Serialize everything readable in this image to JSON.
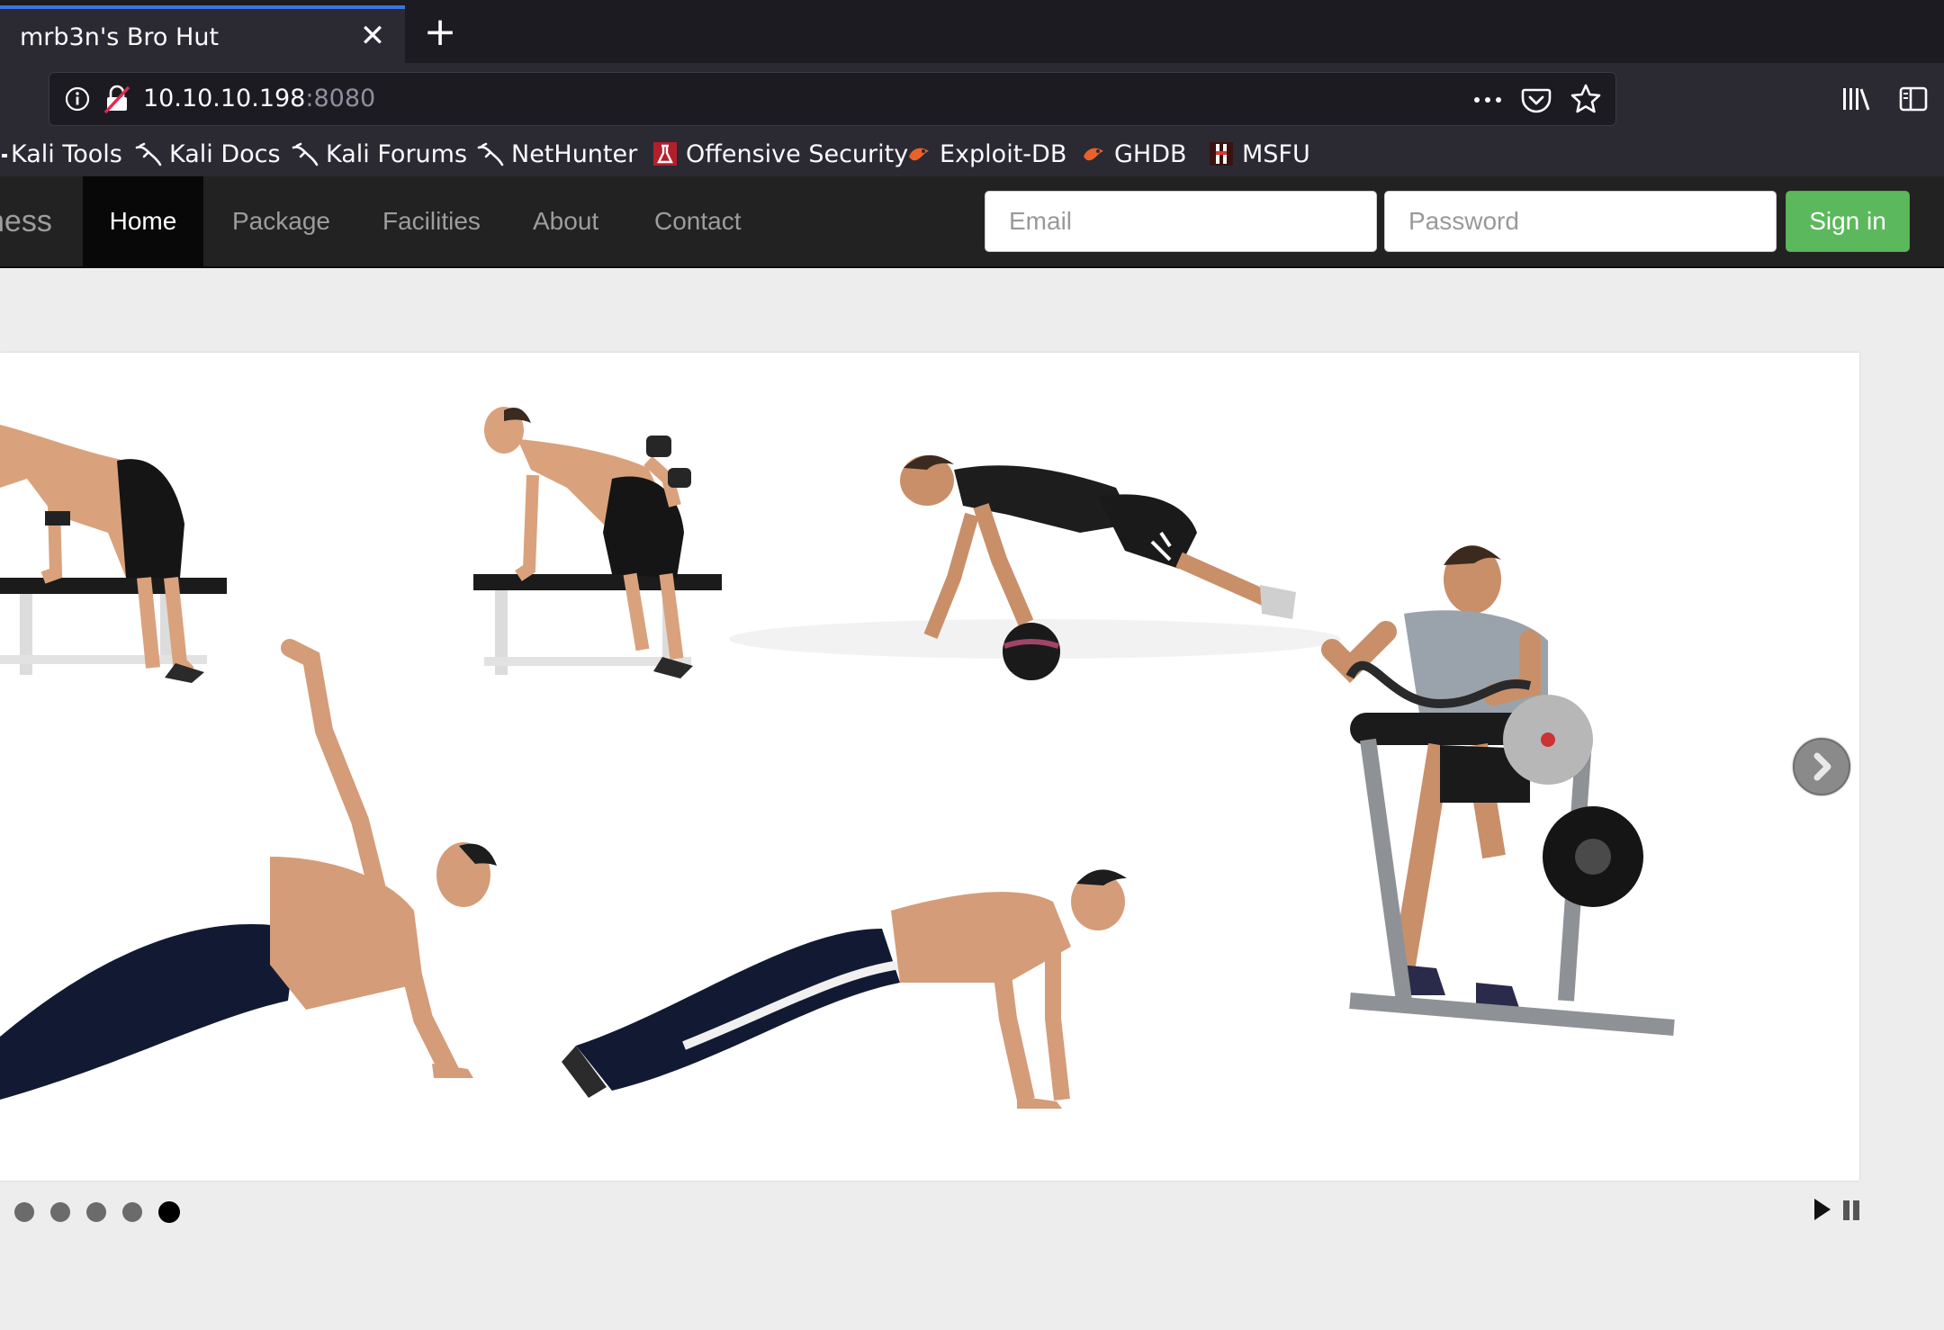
{
  "browser": {
    "tab_title": "mrb3n's Bro Hut",
    "tab_close_glyph": "✕",
    "new_tab_glyph": "+",
    "url_host": "10.10.10.198",
    "url_port": ":8080",
    "bookmarks": [
      {
        "label": "Kali Tools",
        "icon": "none"
      },
      {
        "label": "Kali Docs",
        "icon": "kali-dragon-icon"
      },
      {
        "label": "Kali Forums",
        "icon": "kali-dragon-icon"
      },
      {
        "label": "NetHunter",
        "icon": "kali-dragon-icon"
      },
      {
        "label": "Offensive Security",
        "icon": "offsec-icon"
      },
      {
        "label": "Exploit-DB",
        "icon": "exploit-db-icon"
      },
      {
        "label": "GHDB",
        "icon": "exploit-db-icon"
      },
      {
        "label": "MSFU",
        "icon": "msfu-icon"
      }
    ]
  },
  "site": {
    "brand_partial": "ness",
    "nav": [
      {
        "label": "Home",
        "active": true
      },
      {
        "label": "Package",
        "active": false
      },
      {
        "label": "Facilities",
        "active": false
      },
      {
        "label": "About",
        "active": false
      },
      {
        "label": "Contact",
        "active": false
      }
    ],
    "email_placeholder": "Email",
    "password_placeholder": "Password",
    "signin_label": "Sign in"
  },
  "slider": {
    "slide_count": 5,
    "active_slide": 5,
    "image_description_icons": [
      "dumbbell-row-figure",
      "pushup-medicine-ball-figure",
      "side-plank-figure",
      "pushup-figure",
      "preacher-curl-figure"
    ]
  },
  "colors": {
    "tab_accent": "#3b74e0",
    "navbar_bg": "#222222",
    "signin_green": "#5cb85c",
    "page_bg": "#ededed"
  }
}
